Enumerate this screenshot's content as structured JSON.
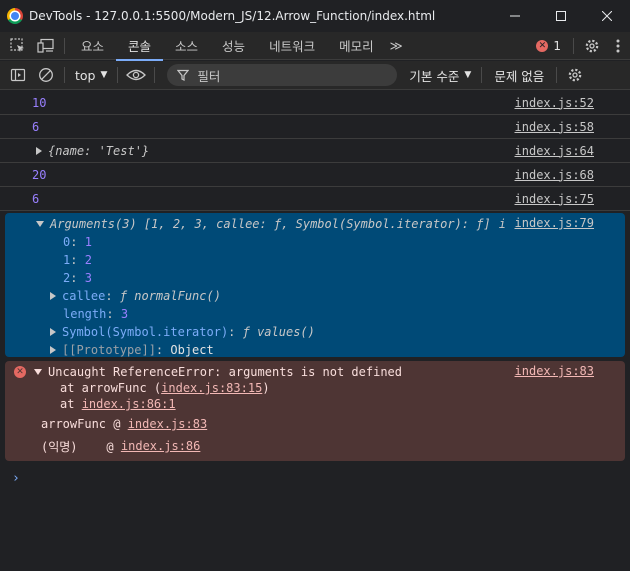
{
  "window": {
    "title": "DevTools - 127.0.0.1:5500/Modern_JS/12.Arrow_Function/index.html",
    "min_icon": "minimize-icon",
    "max_icon": "maximize-icon",
    "close_icon": "close-icon"
  },
  "tabs": {
    "items": [
      {
        "label": "요소"
      },
      {
        "label": "콘솔"
      },
      {
        "label": "소스"
      },
      {
        "label": "성능"
      },
      {
        "label": "네트워크"
      },
      {
        "label": "메모리"
      }
    ],
    "more": "≫",
    "error_count": "1",
    "active": "콘솔"
  },
  "toolbar": {
    "context": "top",
    "filter_placeholder": "필터",
    "levels": "기본 수준",
    "issues": "문제 없음"
  },
  "console": {
    "rows": [
      {
        "value": "10",
        "source": "index.js:52"
      },
      {
        "value": "6",
        "source": "index.js:58"
      },
      {
        "value": "{name: 'Test'}",
        "source": "index.js:64"
      },
      {
        "value": "20",
        "source": "index.js:68"
      },
      {
        "value": "6",
        "source": "index.js:75"
      }
    ],
    "arguments": {
      "header": "Arguments(3) [1, 2, 3, callee: ƒ, Symbol(Symbol.iterator): ƒ]",
      "info": "i",
      "source": "index.js:79",
      "items": [
        {
          "key": "0",
          "value": "1"
        },
        {
          "key": "1",
          "value": "2"
        },
        {
          "key": "2",
          "value": "3"
        }
      ],
      "callee_key": "callee",
      "callee_val": "ƒ normalFunc()",
      "length_key": "length",
      "length_val": "3",
      "symbol_key": "Symbol(Symbol.iterator)",
      "symbol_val": "ƒ values()",
      "proto_key": "[[Prototype]]",
      "proto_val": "Object"
    },
    "error": {
      "message": "Uncaught ReferenceError: arguments is not defined",
      "source": "index.js:83",
      "stack1_prefix": "at arrowFunc (",
      "stack1_link": "index.js:83:15",
      "stack1_suffix": ")",
      "stack2_prefix": "at ",
      "stack2_link": "index.js:86:1",
      "frame1_name": "arrowFunc @ ",
      "frame1_link": "index.js:83",
      "frame2_name": "(익명)    @ ",
      "frame2_link": "index.js:86"
    },
    "prompt": "›"
  },
  "colors": {
    "accent": "#7cacf8",
    "number": "#9980ff",
    "selected_bg": "#004a77",
    "error_bg": "#4e3534",
    "error_icon": "#e46962"
  }
}
